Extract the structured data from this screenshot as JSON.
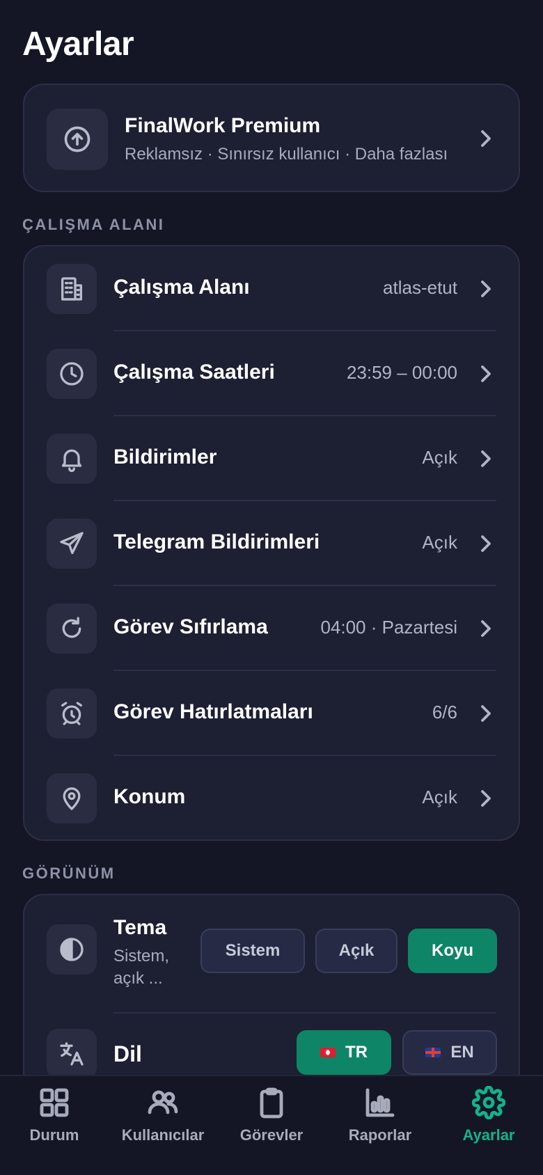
{
  "page": {
    "title": "Ayarlar"
  },
  "premium": {
    "title": "FinalWork Premium",
    "subtitle": "Reklamsız · Sınırsız kullanıcı · Daha fazlası",
    "icon": "arrow-up-circle-icon"
  },
  "workspace_section": {
    "label": "ÇALIŞMA ALANI",
    "items": [
      {
        "label": "Çalışma Alanı",
        "value": "atlas-etut",
        "icon": "building-icon"
      },
      {
        "label": "Çalışma Saatleri",
        "value": "23:59 – 00:00",
        "icon": "clock-icon"
      },
      {
        "label": "Bildirimler",
        "value": "Açık",
        "icon": "bell-icon"
      },
      {
        "label": "Telegram Bildirimleri",
        "value": "Açık",
        "icon": "send-icon"
      },
      {
        "label": "Görev Sıfırlama",
        "value": "04:00 · Pazartesi",
        "icon": "refresh-icon"
      },
      {
        "label": "Görev Hatırlatmaları",
        "value": "6/6",
        "icon": "alarm-clock-icon"
      },
      {
        "label": "Konum",
        "value": "Açık",
        "icon": "map-pin-icon"
      }
    ]
  },
  "appearance_section": {
    "label": "GÖRÜNÜM",
    "theme": {
      "title": "Tema",
      "subtitle": "Sistem, açık ...",
      "options": [
        "Sistem",
        "Açık",
        "Koyu"
      ],
      "selected": "Koyu"
    },
    "language": {
      "title": "Dil",
      "options": [
        "TR",
        "EN"
      ],
      "selected": "TR"
    }
  },
  "tabbar": {
    "items": [
      {
        "label": "Durum",
        "icon": "grid-icon"
      },
      {
        "label": "Kullanıcılar",
        "icon": "users-icon"
      },
      {
        "label": "Görevler",
        "icon": "clipboard-icon"
      },
      {
        "label": "Raporlar",
        "icon": "bar-chart-icon"
      },
      {
        "label": "Ayarlar",
        "icon": "gear-icon"
      }
    ],
    "active": "Ayarlar"
  },
  "colors": {
    "accent": "#0e8566",
    "accent_text": "#14b38a",
    "background": "#141626",
    "card": "#1d2033"
  }
}
